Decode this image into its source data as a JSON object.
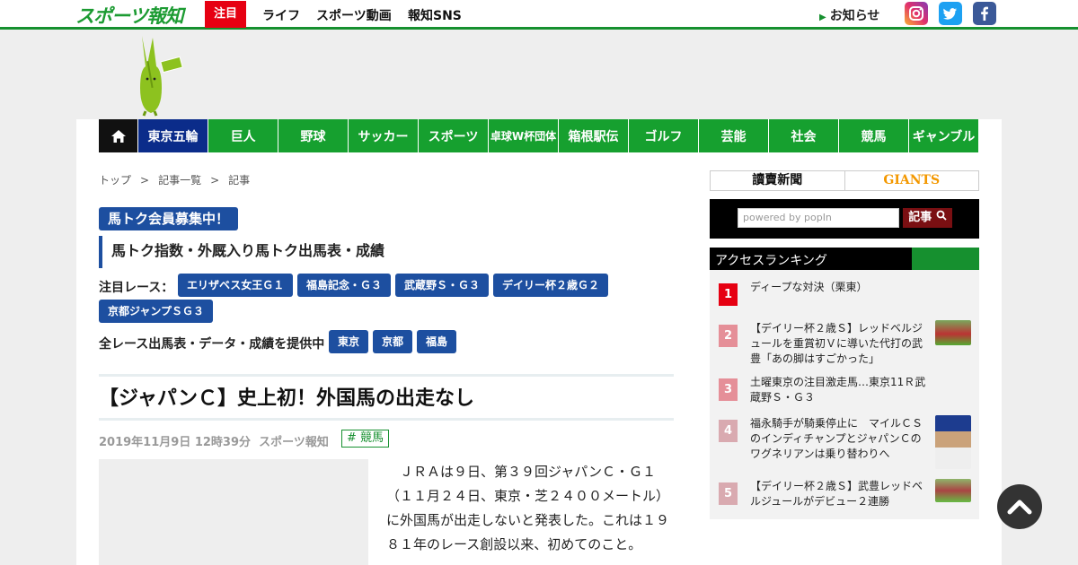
{
  "header": {
    "logo_text": "スポーツ報知",
    "focus_label": "注目",
    "nav": [
      "ライフ",
      "スポーツ動画",
      "報知SNS"
    ],
    "news_label": "お知らせ",
    "social": {
      "instagram": "instagram-icon",
      "twitter": "twitter-icon",
      "facebook": "facebook-icon"
    }
  },
  "categories": [
    "東京五輪",
    "巨人",
    "野球",
    "サッカー",
    "スポーツ",
    "卓球W杯団体",
    "箱根駅伝",
    "ゴルフ",
    "芸能",
    "社会",
    "競馬",
    "ギャンブル"
  ],
  "active_category": "東京五輪",
  "breadcrumb": [
    "トップ",
    "記事一覧",
    "記事"
  ],
  "breadcrumb_sep": ">",
  "promo": {
    "badge": "馬トク会員募集中！",
    "link": "馬トク指数・外厩入り馬トク出馬表・成績",
    "featured_label": "注目レース：",
    "featured_races": [
      "エリザベス女王Ｇ１",
      "福島記念・Ｇ３",
      "武蔵野Ｓ・Ｇ３",
      "デイリー杯２歳Ｇ２",
      "京都ジャンプＳＧ３"
    ],
    "all_races_label": "全レース出馬表・データ・成績を提供中",
    "venues": [
      "東京",
      "京都",
      "福島"
    ]
  },
  "article": {
    "title": "【ジャパンＣ】史上初！外国馬の出走なし",
    "date": "2019年11月9日 12時39分",
    "source": "スポーツ報知",
    "tag": "# 競馬",
    "body": "ＪＲＡは９日、第３９回ジャパンＣ・Ｇ１（１１月２４日、東京・芝２４００メートル）に外国馬が出走しないと発表した。これは１９８１年のレース創設以来、初めてのこと。"
  },
  "sidebar": {
    "partners": [
      "讀賣新聞",
      "GIANTS"
    ],
    "search_placeholder": "powered by popIn",
    "search_button": "記事",
    "ranking_title": "アクセスランキング",
    "ranking": [
      {
        "rank": "1",
        "text": "ディープな対決（栗東）",
        "color": "#e60012"
      },
      {
        "rank": "2",
        "text": "【デイリー杯２歳Ｓ】レッドベルジュールを重賞初Ｖに導いた代打の武豊「あの脚はすごかった」",
        "color": "#e58f98"
      },
      {
        "rank": "3",
        "text": "土曜東京の注目激走馬…東京11Ｒ武蔵野Ｓ・Ｇ３",
        "color": "#e58f98"
      },
      {
        "rank": "4",
        "text": "福永騎手が騎乗停止に　マイルＣＳのインディチャンプとジャパンＣのワグネリアンは乗り替わりへ",
        "color": "#d9aab0"
      },
      {
        "rank": "5",
        "text": "【デイリー杯２歳Ｓ】武豊レッドベルジュールがデビュー２連勝",
        "color": "#d9aab0"
      }
    ]
  },
  "colors": {
    "brand_green": "#16902f",
    "nav_active": "#0b2c8a",
    "pill_blue": "#1d4fa0",
    "focus_red": "#e60012"
  }
}
